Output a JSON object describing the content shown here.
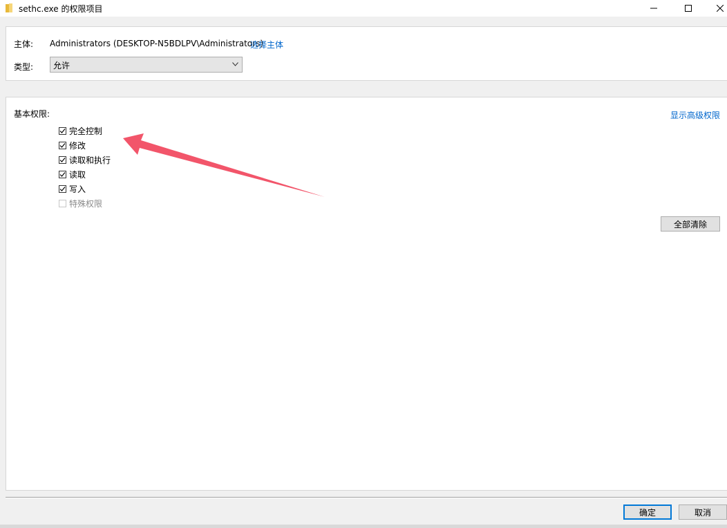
{
  "window": {
    "title": "sethc.exe 的权限项目",
    "icon": "folder-icon"
  },
  "principal": {
    "label": "主体:",
    "value": "Administrators (DESKTOP-N5BDLPV\\Administrators)",
    "select_link": "选择主体"
  },
  "type": {
    "label": "类型:",
    "selected": "允许"
  },
  "permissions": {
    "section_label": "基本权限:",
    "show_advanced_link": "显示高级权限",
    "items": [
      {
        "label": "完全控制",
        "checked": true,
        "enabled": true
      },
      {
        "label": "修改",
        "checked": true,
        "enabled": true
      },
      {
        "label": "读取和执行",
        "checked": true,
        "enabled": true
      },
      {
        "label": "读取",
        "checked": true,
        "enabled": true
      },
      {
        "label": "写入",
        "checked": true,
        "enabled": true
      },
      {
        "label": "特殊权限",
        "checked": false,
        "enabled": false
      }
    ],
    "clear_all_button": "全部清除"
  },
  "footer": {
    "ok_button": "确定",
    "cancel_button": "取消"
  },
  "colors": {
    "link": "#0066cc",
    "annotation_arrow": "#f2556a",
    "focus_border": "#0078d7"
  }
}
